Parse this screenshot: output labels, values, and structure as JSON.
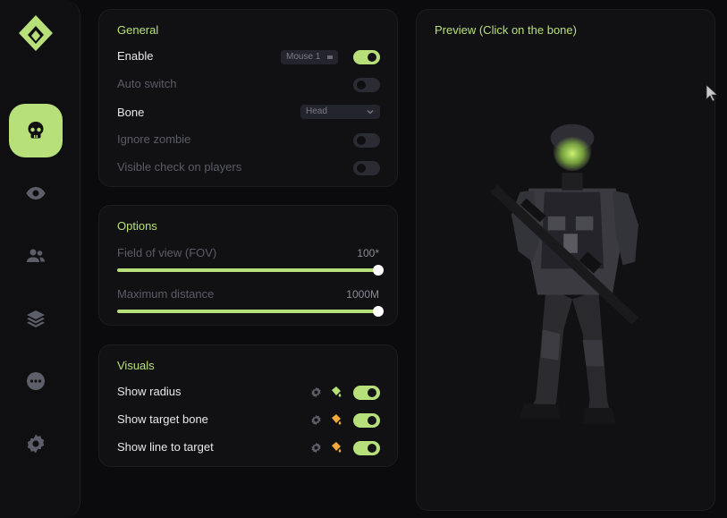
{
  "colors": {
    "accent": "#b8e07a",
    "background": "#0b0b0d",
    "card": "#111114",
    "dim_text": "#5c5c66",
    "paint_bucket": "#f0a83a"
  },
  "sidebar": {
    "logo_icon": "diamond-logo-icon",
    "items": [
      {
        "icon": "skull-icon",
        "active": true
      },
      {
        "icon": "eye-icon",
        "active": false
      },
      {
        "icon": "users-icon",
        "active": false
      },
      {
        "icon": "layers-icon",
        "active": false
      },
      {
        "icon": "more-icon",
        "active": false
      },
      {
        "icon": "gear-icon",
        "active": false
      }
    ]
  },
  "general": {
    "title": "General",
    "enable": {
      "label": "Enable",
      "keybind": "Mouse 1",
      "on": true
    },
    "auto_switch": {
      "label": "Auto switch",
      "on": false
    },
    "bone": {
      "label": "Bone",
      "value": "Head"
    },
    "ignore_zombie": {
      "label": "Ignore zombie",
      "on": false
    },
    "visible_check": {
      "label": "Visible check on players",
      "on": false
    }
  },
  "options": {
    "title": "Options",
    "fov": {
      "label": "Field of view (FOV)",
      "value": "100*",
      "fraction": 1.0
    },
    "max_distance": {
      "label": "Maximum distance",
      "value": "1000M",
      "fraction": 1.0
    }
  },
  "visuals": {
    "title": "Visuals",
    "show_radius": {
      "label": "Show radius",
      "on": true
    },
    "show_target_bone": {
      "label": "Show target bone",
      "on": true
    },
    "show_line": {
      "label": "Show line to target",
      "on": true
    }
  },
  "preview": {
    "title": "Preview (Click on the bone)"
  }
}
